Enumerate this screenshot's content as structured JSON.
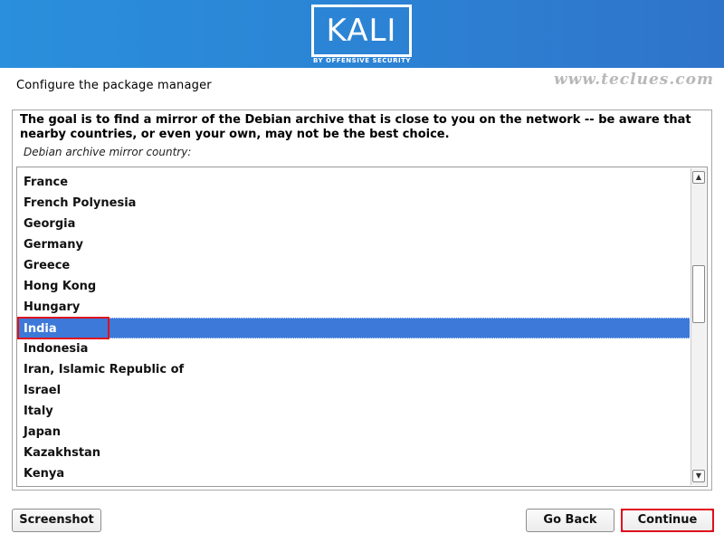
{
  "header": {
    "logo_text": "KALI",
    "logo_subtitle": "BY OFFENSIVE SECURITY",
    "brand_color": "#2b86d6"
  },
  "page": {
    "title": "Configure the package manager",
    "watermark": "www.teclues.com"
  },
  "content": {
    "description": "The goal is to find a mirror of the Debian archive that is close to you on the network -- be aware that nearby countries, or even your own, may not be the best choice.",
    "list_label": "Debian archive mirror country:",
    "countries": [
      "France",
      "French Polynesia",
      "Georgia",
      "Germany",
      "Greece",
      "Hong Kong",
      "Hungary",
      "India",
      "Indonesia",
      "Iran, Islamic Republic of",
      "Israel",
      "Italy",
      "Japan",
      "Kazakhstan",
      "Kenya"
    ],
    "selected_country": "India",
    "selection_color": "#3d79d8",
    "highlight_color": "#e0101d"
  },
  "buttons": {
    "screenshot": "Screenshot",
    "go_back": "Go Back",
    "continue": "Continue"
  }
}
